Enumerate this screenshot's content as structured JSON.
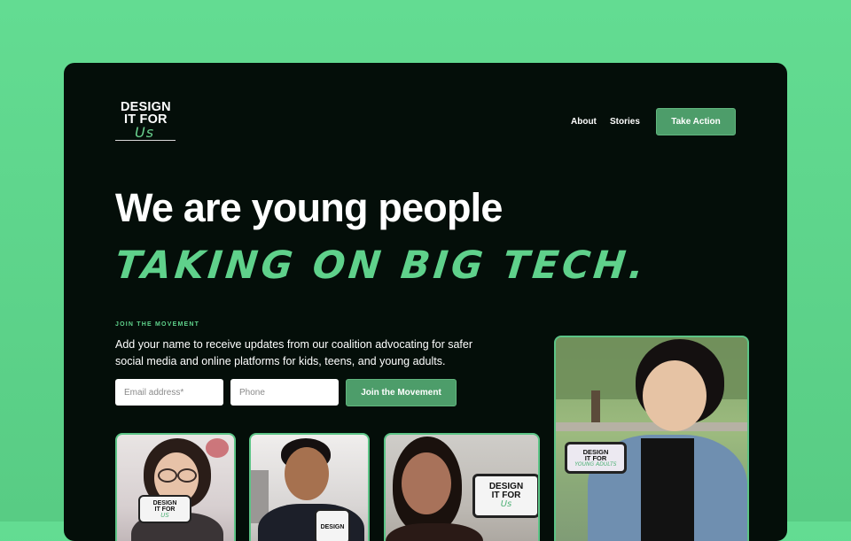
{
  "logo": {
    "line1": "DESIGN",
    "line2": "IT FOR",
    "line3": "Us"
  },
  "nav": {
    "about": "About",
    "stories": "Stories",
    "cta": "Take Action"
  },
  "hero": {
    "headline": "We are young people",
    "tagline": "TAKING ON BIG TECH."
  },
  "signup": {
    "eyebrow": "JOIN THE MOVEMENT",
    "description": "Add your name to receive updates from our coalition advocating for safer social media and online platforms for kids, teens, and young adults.",
    "email_placeholder": "Email address*",
    "phone_placeholder": "Phone",
    "submit_label": "Join the Movement"
  },
  "photo_signs": {
    "card1": {
      "l1": "DESIGN",
      "l2": "IT FOR",
      "l3": "US"
    },
    "card2": {
      "l1": "DESIGN"
    },
    "card3": {
      "l1": "DESIGN",
      "l2": "IT FOR",
      "l3": "Us"
    },
    "card4": {
      "l1": "DESIGN",
      "l2": "IT FOR",
      "l3": "YOUNG ADULTS"
    }
  },
  "colors": {
    "accent": "#5fd18b",
    "button": "#4d9d6a",
    "background": "#040e09",
    "page_bg": "#63dc92"
  }
}
